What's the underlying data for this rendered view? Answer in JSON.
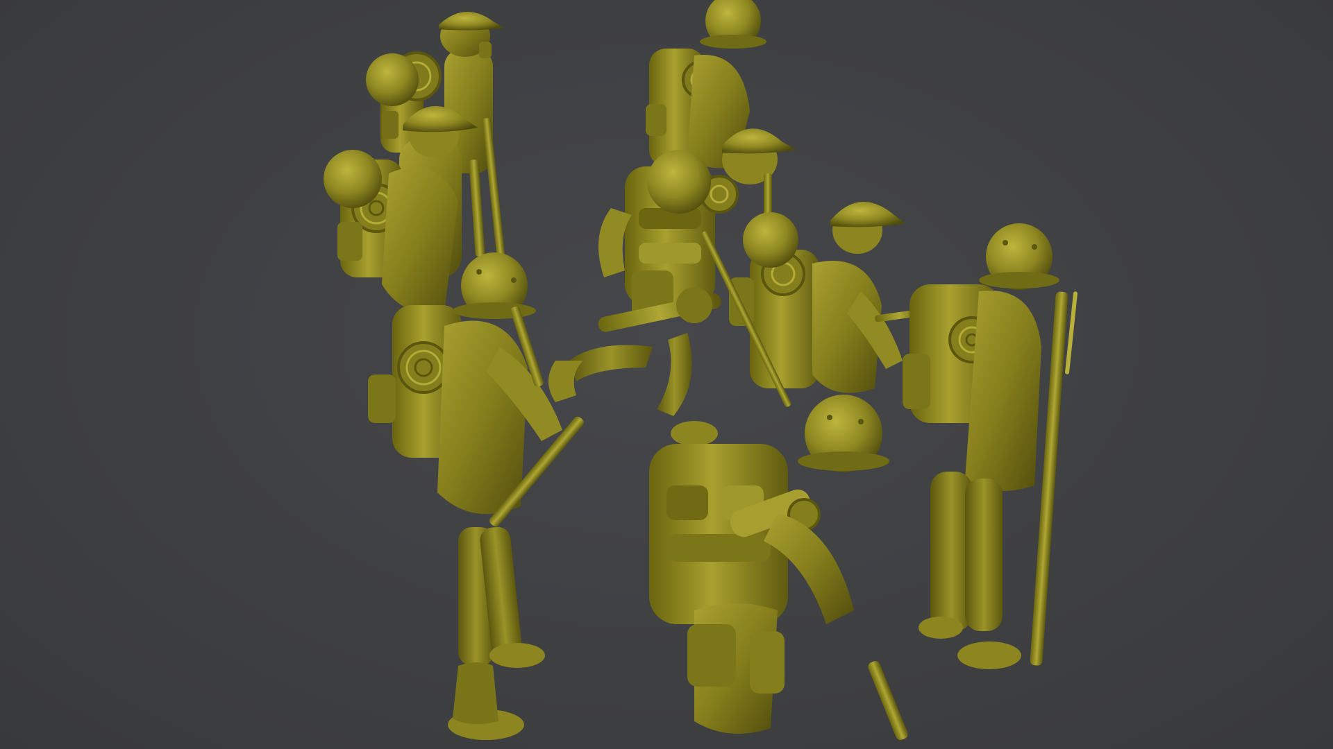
{
  "scene": {
    "background_color": "#404143",
    "model_color": "#8a8420",
    "model_highlight": "#b0a935",
    "model_shadow": "#5a560f",
    "figures": [
      {
        "name": "soldier-figure-cap-rear-left",
        "headwear": "cap-icon"
      },
      {
        "name": "soldier-figure-helmet-rear-left",
        "headwear": "helmet-icon"
      },
      {
        "name": "soldier-figure-cap-mid-left",
        "headwear": "cap-icon"
      },
      {
        "name": "soldier-figure-helmet-far-left",
        "headwear": "helmet-icon"
      },
      {
        "name": "soldier-figure-helmet-front-left",
        "headwear": "helmet-icon"
      },
      {
        "name": "soldier-figure-helmet-rear-right",
        "headwear": "helmet-icon"
      },
      {
        "name": "soldier-figure-cap-center",
        "headwear": "cap-icon"
      },
      {
        "name": "soldier-figure-helmet-center-backpack",
        "headwear": "helmet-icon"
      },
      {
        "name": "soldier-figure-running-center",
        "headwear": "helmet-icon"
      },
      {
        "name": "soldier-figure-cap-center-right",
        "headwear": "cap-icon"
      },
      {
        "name": "soldier-figure-helmet-right",
        "headwear": "helmet-icon"
      },
      {
        "name": "soldier-figure-helmet-front-center",
        "headwear": "helmet-icon"
      }
    ]
  }
}
